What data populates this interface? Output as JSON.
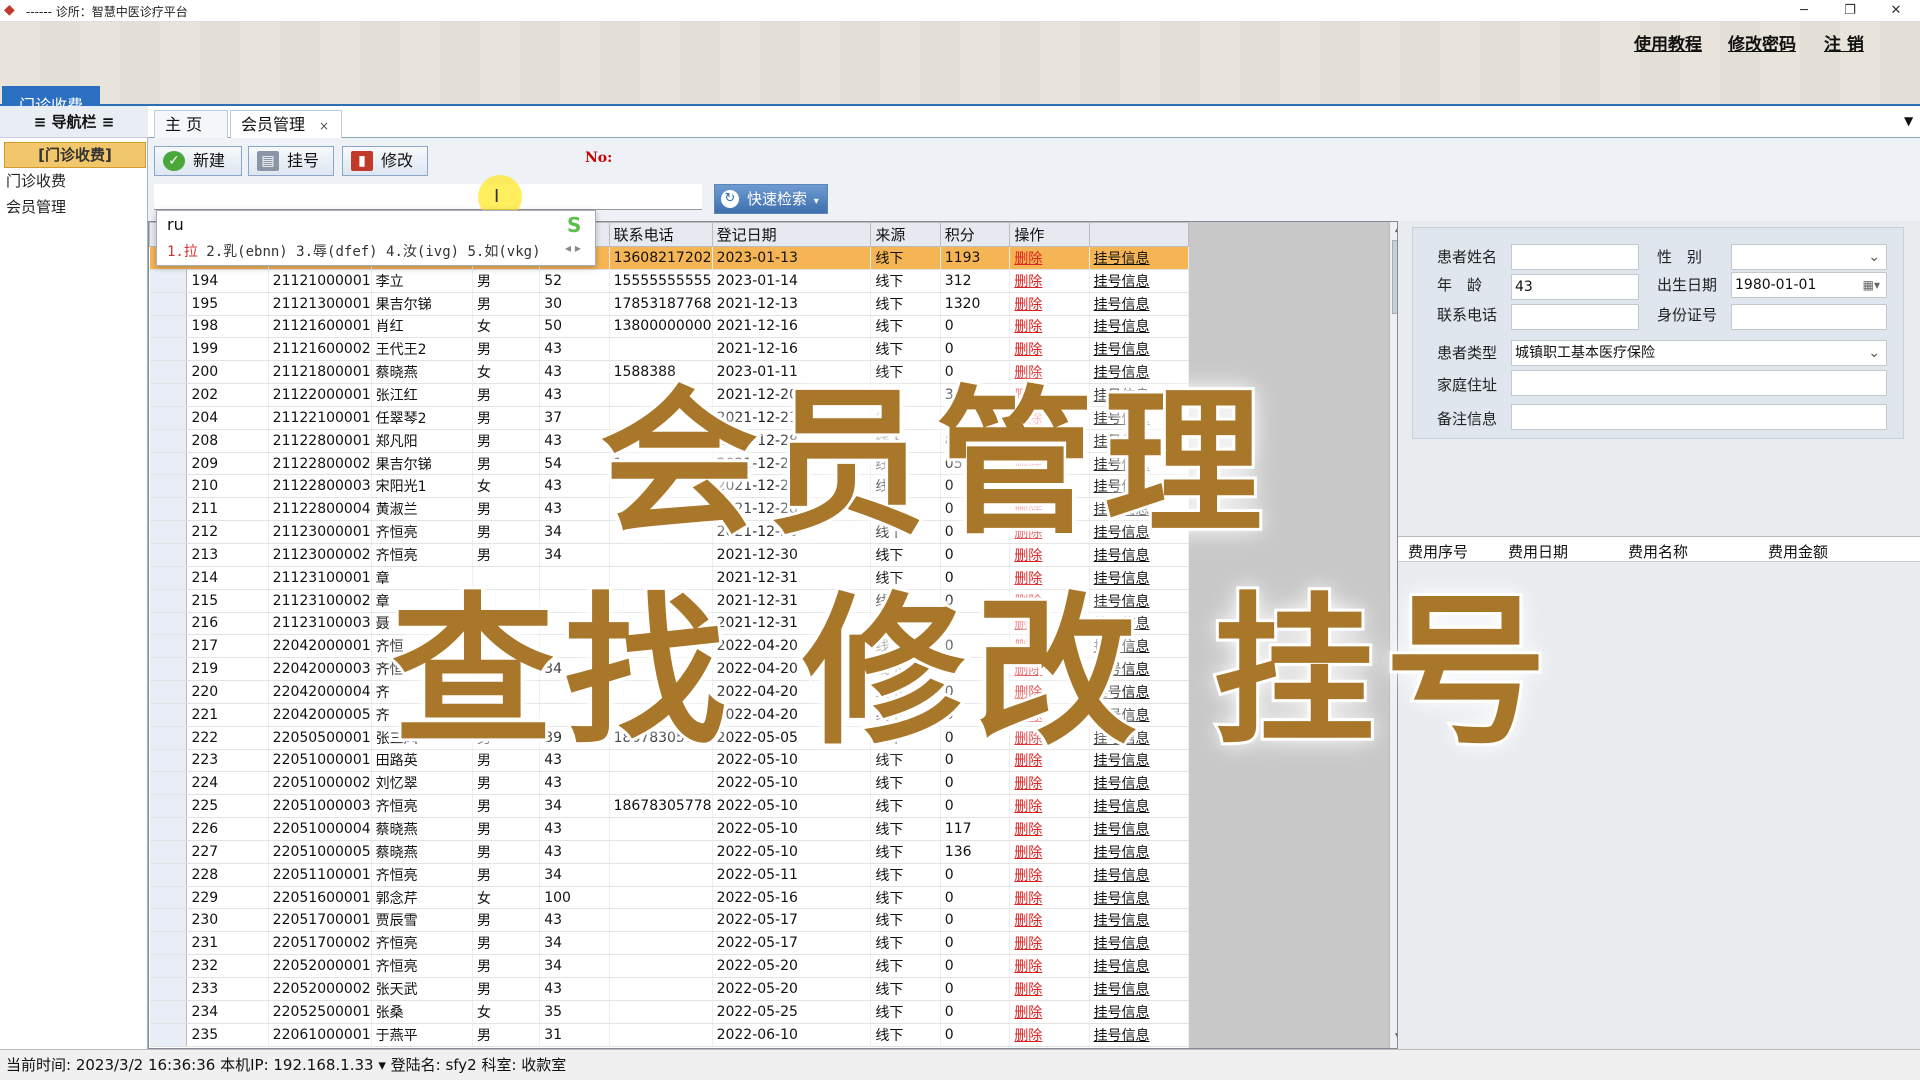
{
  "window": {
    "title": "------ 诊所：智慧中医诊疗平台",
    "min": "─",
    "restore": "❐",
    "close": "✕"
  },
  "header": {
    "links": [
      "使用教程",
      "修改密码",
      "注 销"
    ],
    "module_tab": "门诊收费"
  },
  "nav": {
    "title": "≡ 导航栏 ≡",
    "group": "[门诊收费]",
    "items": [
      "门诊收费",
      "会员管理"
    ]
  },
  "tabs": [
    {
      "label": "主 页"
    },
    {
      "label": "会员管理",
      "close": "×"
    }
  ],
  "toolbar": {
    "new": "新建",
    "register": "挂号",
    "modify": "修改",
    "no_label": "No:",
    "quick_search": "快速检索"
  },
  "ime": {
    "code": "ru",
    "candidates": [
      "1.拉",
      "2.乳(ebnn)",
      "3.辱(dfef)",
      "4.汝(ivg)",
      "5.如(vkg)"
    ],
    "nav": "◂ ▸"
  },
  "grid": {
    "visible_headers": {
      "phone": "联系电话",
      "date": "登记日期",
      "source": "来源",
      "points": "积分",
      "ops": "操作"
    },
    "delete_label": "删除",
    "reg_label": "挂号信息",
    "rows": [
      {
        "id": "",
        "card": "",
        "name": "",
        "sex": "",
        "age": "",
        "phone": "13608217202",
        "date": "2023-01-13",
        "src": "线下",
        "pts": "1193",
        "selected": true
      },
      {
        "id": "194",
        "card": "21121000001",
        "name": "李立",
        "sex": "男",
        "age": "52",
        "phone": "15555555555",
        "date": "2023-01-14",
        "src": "线下",
        "pts": "312"
      },
      {
        "id": "195",
        "card": "21121300001",
        "name": "果吉尔锑",
        "sex": "男",
        "age": "30",
        "phone": "17853187768",
        "date": "2021-12-13",
        "src": "线下",
        "pts": "1320"
      },
      {
        "id": "198",
        "card": "21121600001",
        "name": "肖红",
        "sex": "女",
        "age": "50",
        "phone": "13800000000",
        "date": "2021-12-16",
        "src": "线下",
        "pts": "0"
      },
      {
        "id": "199",
        "card": "21121600002",
        "name": "王代王2",
        "sex": "男",
        "age": "43",
        "phone": "",
        "date": "2021-12-16",
        "src": "线下",
        "pts": "0"
      },
      {
        "id": "200",
        "card": "21121800001",
        "name": "蔡晓燕",
        "sex": "女",
        "age": "43",
        "phone": "1588388",
        "date": "2023-01-11",
        "src": "线下",
        "pts": "0"
      },
      {
        "id": "202",
        "card": "21122000001",
        "name": "张江红",
        "sex": "男",
        "age": "43",
        "phone": "",
        "date": "2021-12-20",
        "src": "线下",
        "pts": "33"
      },
      {
        "id": "204",
        "card": "21122100001",
        "name": "任翠琴2",
        "sex": "男",
        "age": "37",
        "phone": "",
        "date": "2021-12-21",
        "src": "线下",
        "pts": "0"
      },
      {
        "id": "208",
        "card": "21122800001",
        "name": "郑凡阳",
        "sex": "男",
        "age": "43",
        "phone": "",
        "date": "2021-12-28",
        "src": "线下",
        "pts": "8"
      },
      {
        "id": "209",
        "card": "21122800002",
        "name": "果吉尔锑",
        "sex": "男",
        "age": "54",
        "phone": "1",
        "date": "2021-12-28",
        "src": "线下",
        "pts": "05"
      },
      {
        "id": "210",
        "card": "21122800003",
        "name": "宋阳光1",
        "sex": "女",
        "age": "43",
        "phone": "",
        "date": "2021-12-28",
        "src": "线下",
        "pts": "0"
      },
      {
        "id": "211",
        "card": "21122800004",
        "name": "黄淑兰",
        "sex": "男",
        "age": "43",
        "phone": "",
        "date": "2021-12-28",
        "src": "线下",
        "pts": "0"
      },
      {
        "id": "212",
        "card": "21123000001",
        "name": "齐恒亮",
        "sex": "男",
        "age": "34",
        "phone": "",
        "date": "2021-12-30",
        "src": "线下",
        "pts": "0"
      },
      {
        "id": "213",
        "card": "21123000002",
        "name": "齐恒亮",
        "sex": "男",
        "age": "34",
        "phone": "",
        "date": "2021-12-30",
        "src": "线下",
        "pts": "0"
      },
      {
        "id": "214",
        "card": "21123100001",
        "name": "章",
        "sex": "",
        "age": "",
        "phone": "",
        "date": "2021-12-31",
        "src": "线下",
        "pts": "0"
      },
      {
        "id": "215",
        "card": "21123100002",
        "name": "章",
        "sex": "",
        "age": "",
        "phone": "",
        "date": "2021-12-31",
        "src": "线下",
        "pts": "0"
      },
      {
        "id": "216",
        "card": "21123100003",
        "name": "聂",
        "sex": "",
        "age": "",
        "phone": "",
        "date": "2021-12-31",
        "src": "线下",
        "pts": "0"
      },
      {
        "id": "217",
        "card": "22042000001",
        "name": "齐恒",
        "sex": "",
        "age": "",
        "phone": "",
        "date": "2022-04-20",
        "src": "线下",
        "pts": "0"
      },
      {
        "id": "219",
        "card": "22042000003",
        "name": "齐恒",
        "sex": "",
        "age": "34",
        "phone": "",
        "date": "2022-04-20",
        "src": "线下",
        "pts": "0"
      },
      {
        "id": "220",
        "card": "22042000004",
        "name": "齐",
        "sex": "",
        "age": "",
        "phone": "",
        "date": "2022-04-20",
        "src": "线下",
        "pts": "0"
      },
      {
        "id": "221",
        "card": "22042000005",
        "name": "齐",
        "sex": "",
        "age": "",
        "phone": "",
        "date": "2022-04-20",
        "src": "线下",
        "pts": "0"
      },
      {
        "id": "222",
        "card": "22050500001",
        "name": "张三风",
        "sex": "男",
        "age": "39",
        "phone": "18678305778",
        "date": "2022-05-05",
        "src": "线下",
        "pts": "0"
      },
      {
        "id": "223",
        "card": "22051000001",
        "name": "田路英",
        "sex": "男",
        "age": "43",
        "phone": "",
        "date": "2022-05-10",
        "src": "线下",
        "pts": "0"
      },
      {
        "id": "224",
        "card": "22051000002",
        "name": "刘忆翠",
        "sex": "男",
        "age": "43",
        "phone": "",
        "date": "2022-05-10",
        "src": "线下",
        "pts": "0"
      },
      {
        "id": "225",
        "card": "22051000003",
        "name": "齐恒亮",
        "sex": "男",
        "age": "34",
        "phone": "18678305778",
        "date": "2022-05-10",
        "src": "线下",
        "pts": "0"
      },
      {
        "id": "226",
        "card": "22051000004",
        "name": "蔡晓燕",
        "sex": "男",
        "age": "43",
        "phone": "",
        "date": "2022-05-10",
        "src": "线下",
        "pts": "117"
      },
      {
        "id": "227",
        "card": "22051000005",
        "name": "蔡晓燕",
        "sex": "男",
        "age": "43",
        "phone": "",
        "date": "2022-05-10",
        "src": "线下",
        "pts": "136"
      },
      {
        "id": "228",
        "card": "22051100001",
        "name": "齐恒亮",
        "sex": "男",
        "age": "34",
        "phone": "",
        "date": "2022-05-11",
        "src": "线下",
        "pts": "0"
      },
      {
        "id": "229",
        "card": "22051600001",
        "name": "郭念芹",
        "sex": "女",
        "age": "100",
        "phone": "",
        "date": "2022-05-16",
        "src": "线下",
        "pts": "0"
      },
      {
        "id": "230",
        "card": "22051700001",
        "name": "贾辰雪",
        "sex": "男",
        "age": "43",
        "phone": "",
        "date": "2022-05-17",
        "src": "线下",
        "pts": "0"
      },
      {
        "id": "231",
        "card": "22051700002",
        "name": "齐恒亮",
        "sex": "男",
        "age": "34",
        "phone": "",
        "date": "2022-05-17",
        "src": "线下",
        "pts": "0"
      },
      {
        "id": "232",
        "card": "22052000001",
        "name": "齐恒亮",
        "sex": "男",
        "age": "34",
        "phone": "",
        "date": "2022-05-20",
        "src": "线下",
        "pts": "0"
      },
      {
        "id": "233",
        "card": "22052000002",
        "name": "张天武",
        "sex": "男",
        "age": "43",
        "phone": "",
        "date": "2022-05-20",
        "src": "线下",
        "pts": "0"
      },
      {
        "id": "234",
        "card": "22052500001",
        "name": "张桑",
        "sex": "女",
        "age": "35",
        "phone": "",
        "date": "2022-05-25",
        "src": "线下",
        "pts": "0"
      },
      {
        "id": "235",
        "card": "22061000001",
        "name": "于燕平",
        "sex": "男",
        "age": "31",
        "phone": "",
        "date": "2022-06-10",
        "src": "线下",
        "pts": "0"
      }
    ]
  },
  "form": {
    "name_label": "患者姓名",
    "name_value": "",
    "sex_label": "性　别",
    "sex_value": "",
    "age_label": "年　龄",
    "age_value": "43",
    "dob_label": "出生日期",
    "dob_value": "1980-01-01",
    "phone_label": "联系电话",
    "phone_value": "",
    "id_label": "身份证号",
    "id_value": "",
    "type_label": "患者类型",
    "type_value": "城镇职工基本医疗保险",
    "addr_label": "家庭住址",
    "addr_value": "",
    "note_label": "备注信息",
    "note_value": ""
  },
  "fees": {
    "headers": [
      "费用序号",
      "费用日期",
      "费用名称",
      "费用金额"
    ]
  },
  "overlay": {
    "line1": "会员管理",
    "line2": "查找 修改 挂号"
  },
  "status": {
    "text": "当前时间: 2023/3/2 16:36:36  本机IP: 192.168.1.33  ▾  登陆名: sfy2  科室: 收款室"
  },
  "colors": {
    "accent": "#2a6fc0",
    "selected_row": "#f6b554",
    "overlay": "#a8772a",
    "delete": "#d22"
  }
}
